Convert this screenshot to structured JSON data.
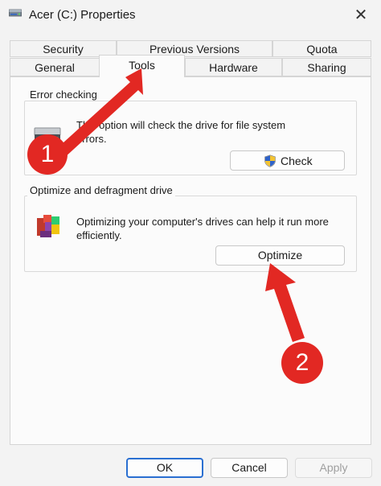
{
  "window": {
    "title": "Acer (C:) Properties",
    "close_symbol": "✕",
    "icon": "drive-icon"
  },
  "tabs": {
    "row1": [
      "Security",
      "Previous Versions",
      "Quota"
    ],
    "row2": [
      "General",
      "Tools",
      "Hardware",
      "Sharing"
    ],
    "active": "Tools"
  },
  "error_checking": {
    "title": "Error checking",
    "text_line1": "This option will check the drive for file system",
    "text_line2": "errors.",
    "button_label": "Check",
    "icon": "hard-drive-icon",
    "button_icon": "uac-shield-icon"
  },
  "optimize": {
    "title": "Optimize and defragment drive",
    "text_line1": "Optimizing your computer's drives can help it run more",
    "text_line2": "efficiently.",
    "button_label": "Optimize",
    "icon": "defrag-icon"
  },
  "footer": {
    "ok_label": "OK",
    "cancel_label": "Cancel",
    "apply_label": "Apply"
  },
  "annotations": {
    "callout1": "1",
    "callout2": "2",
    "color": "#e22823"
  }
}
